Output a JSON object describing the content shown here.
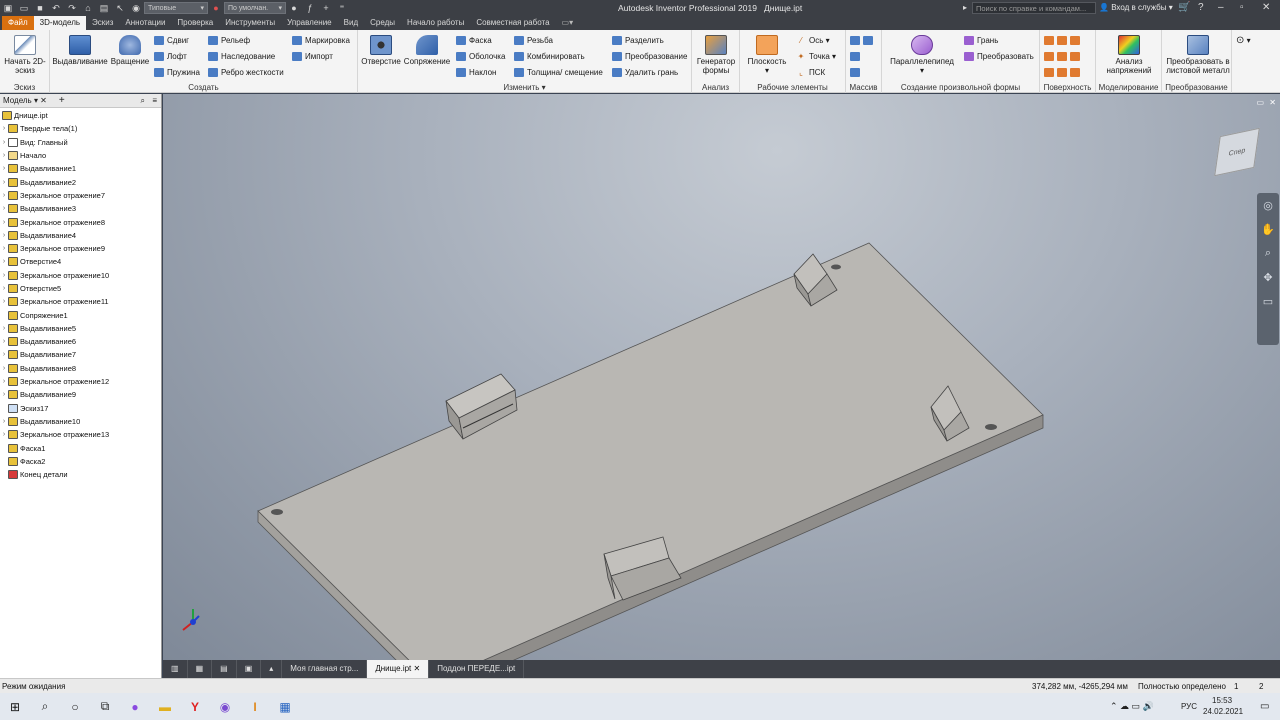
{
  "qat": {
    "appearance": "Типовые",
    "material": "По умолчан.",
    "title": "Autodesk Inventor Professional 2019",
    "doc": "Днище.ipt",
    "search_placeholder": "Поиск по справке и командам...",
    "login": "Вход в службы"
  },
  "tabs": [
    "Файл",
    "3D-модель",
    "Эскиз",
    "Аннотации",
    "Проверка",
    "Инструменты",
    "Управление",
    "Вид",
    "Среды",
    "Начало работы",
    "Совместная работа"
  ],
  "ribbon": {
    "sketch": {
      "btn": "Начать 2D-эскиз",
      "label": "Эскиз"
    },
    "create": {
      "label": "Создать",
      "extrude": "Выдавливание",
      "revolve": "Вращение",
      "sweep": "Сдвиг",
      "loft": "Лофт",
      "coil": "Пружина",
      "emboss": "Рельеф",
      "derive": "Наследование",
      "rib": "Ребро жесткости",
      "decal": "Маркировка",
      "import": "Импорт"
    },
    "modify": {
      "label": "Изменить",
      "hole": "Отверстие",
      "fillet": "Сопряжение",
      "chamfer": "Фаска",
      "shell": "Оболочка",
      "draft": "Наклон",
      "thread": "Резьба",
      "combine": "Комбинировать",
      "thicken": "Толщина/ смещение",
      "split": "Разделить",
      "direct": "Преобразование",
      "delete_face": "Удалить грань"
    },
    "explore": {
      "label": "Анализ",
      "btn": "Генератор формы"
    },
    "work": {
      "label": "Рабочие элементы",
      "plane": "Плоскость",
      "axis": "Ось",
      "point": "Точка",
      "ucs": "ПСК"
    },
    "pattern": {
      "label": "Массив"
    },
    "freeform": {
      "label": "Создание произвольной формы",
      "box": "Параллелепипед",
      "face": "Грань",
      "convert": "Преобразовать"
    },
    "surface": {
      "label": "Поверхность"
    },
    "simulation": {
      "label": "Моделирование",
      "btn": "Анализ напряжений"
    },
    "convert": {
      "label": "Преобразование",
      "btn": "Преобразовать в листовой металл"
    }
  },
  "browser": {
    "tab": "Модель",
    "nodes": [
      {
        "label": "Днище.ipt",
        "icon": "part-icon",
        "color": "#e8c23a",
        "exp": false,
        "root": true
      },
      {
        "label": "Твердые тела(1)",
        "icon": "solid-bodies-icon",
        "color": "#e8c23a",
        "exp": true
      },
      {
        "label": "Вид: Главный",
        "icon": "view-icon",
        "color": "#ffffff",
        "exp": true
      },
      {
        "label": "Начало",
        "icon": "origin-folder-icon",
        "color": "#f3d98a",
        "exp": true
      },
      {
        "label": "Выдавливание1",
        "icon": "extrude-icon",
        "color": "#e8c23a",
        "exp": true
      },
      {
        "label": "Выдавливание2",
        "icon": "extrude-icon",
        "color": "#e8c23a",
        "exp": true
      },
      {
        "label": "Зеркальное отражение7",
        "icon": "mirror-icon",
        "color": "#e8c23a",
        "exp": true
      },
      {
        "label": "Выдавливание3",
        "icon": "extrude-icon",
        "color": "#e8c23a",
        "exp": true
      },
      {
        "label": "Зеркальное отражение8",
        "icon": "mirror-icon",
        "color": "#e8c23a",
        "exp": true
      },
      {
        "label": "Выдавливание4",
        "icon": "extrude-icon",
        "color": "#e8c23a",
        "exp": true
      },
      {
        "label": "Зеркальное отражение9",
        "icon": "mirror-icon",
        "color": "#e8c23a",
        "exp": true
      },
      {
        "label": "Отверстие4",
        "icon": "hole-icon",
        "color": "#e8c23a",
        "exp": true
      },
      {
        "label": "Зеркальное отражение10",
        "icon": "mirror-icon",
        "color": "#e8c23a",
        "exp": true
      },
      {
        "label": "Отверстие5",
        "icon": "hole-icon",
        "color": "#e8c23a",
        "exp": true
      },
      {
        "label": "Зеркальное отражение11",
        "icon": "mirror-icon",
        "color": "#e8c23a",
        "exp": true
      },
      {
        "label": "Сопряжение1",
        "icon": "fillet-icon",
        "color": "#e8c23a",
        "exp": false
      },
      {
        "label": "Выдавливание5",
        "icon": "extrude-icon",
        "color": "#e8c23a",
        "exp": true
      },
      {
        "label": "Выдавливание6",
        "icon": "extrude-icon",
        "color": "#e8c23a",
        "exp": true
      },
      {
        "label": "Выдавливание7",
        "icon": "extrude-icon",
        "color": "#e8c23a",
        "exp": true
      },
      {
        "label": "Выдавливание8",
        "icon": "extrude-icon",
        "color": "#e8c23a",
        "exp": true
      },
      {
        "label": "Зеркальное отражение12",
        "icon": "mirror-icon",
        "color": "#e8c23a",
        "exp": true
      },
      {
        "label": "Выдавливание9",
        "icon": "extrude-icon",
        "color": "#e8c23a",
        "exp": true
      },
      {
        "label": "Эскиз17",
        "icon": "sketch-icon",
        "color": "#cfe0f5",
        "exp": false
      },
      {
        "label": "Выдавливание10",
        "icon": "extrude-icon",
        "color": "#e8c23a",
        "exp": true
      },
      {
        "label": "Зеркальное отражение13",
        "icon": "mirror-icon",
        "color": "#e8c23a",
        "exp": true
      },
      {
        "label": "Фаска1",
        "icon": "chamfer-icon",
        "color": "#e8c23a",
        "exp": false
      },
      {
        "label": "Фаска2",
        "icon": "chamfer-icon",
        "color": "#e8c23a",
        "exp": false
      },
      {
        "label": "Конец детали",
        "icon": "end-of-part-icon",
        "color": "#d63a3a",
        "exp": false
      }
    ]
  },
  "viewcube": {
    "face": "Спер"
  },
  "doctabs": [
    "Моя главная стр...",
    "Днище.ipt",
    "Поддон ПЕРЕДЕ...ipt"
  ],
  "status": {
    "left": "Режим ожидания",
    "coords": "374,282 мм, -4265,294 мм",
    "state": "Полностью определено",
    "n1": "1",
    "n2": "2"
  },
  "taskbar": {
    "lang": "РУС",
    "time": "15:53",
    "date": "24.02.2021"
  },
  "colors": {
    "accent": "#d9700f",
    "part": "#b6b4b1"
  }
}
